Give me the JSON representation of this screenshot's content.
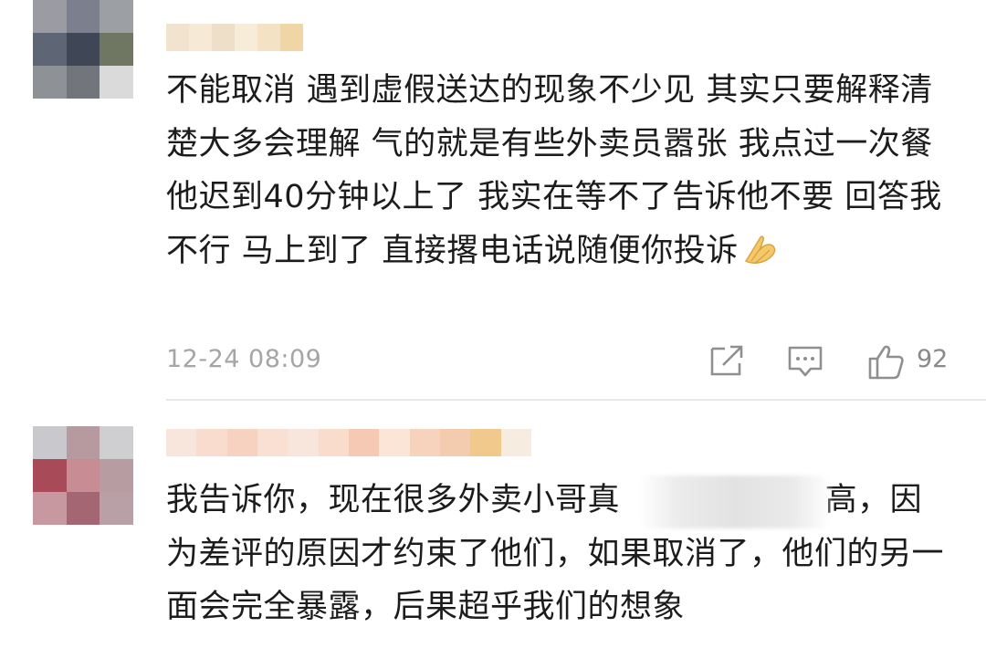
{
  "comments": [
    {
      "avatar_colors": [
        "#9a9ba3",
        "#7b7f8e",
        "#9ca0a4",
        "#5e6575",
        "#3f4656",
        "#6f7763",
        "#8e9196",
        "#72757b",
        "#dadada"
      ],
      "username_colors": [
        "#f2e3cf",
        "#f6ead7",
        "#eedfc9",
        "#f7ecd8",
        "#f3e2c4",
        "#f0d6a4"
      ],
      "text": "不能取消 遇到虚假送达的现象不少见 其实只要解释清楚大多会理解 气的就是有些外卖员嚣张 我点过一次餐 他迟到40分钟以上了 我实在等不了告诉他不要 回答我不行 马上到了 直接撂电话说随便你投诉",
      "emoji": "folded-hands-emoji",
      "timestamp": "12-24 08:09",
      "like_count": "92"
    },
    {
      "avatar_colors": [
        "#c9c9cd",
        "#b79aa0",
        "#cfcfd2",
        "#a94a58",
        "#c88c95",
        "#b79ca2",
        "#c7989f",
        "#a56673",
        "#b8a0a6"
      ],
      "username_colors": [
        "#f8e5dc",
        "#f9dccd",
        "#f7d2c0",
        "#f9e0d3",
        "#f8e6dc",
        "#fadccc",
        "#f6c9b4",
        "#fbe5d6",
        "#f7d3bd",
        "#f3ccb0",
        "#f2c98c",
        "#f7ece0"
      ],
      "text": "我告诉你，现在很多外卖小哥真　　　　　　 高，因为差评的原因才约束了他们，如果取消了，他们的另一面会完全暴露，后果超乎我们的想象"
    }
  ]
}
